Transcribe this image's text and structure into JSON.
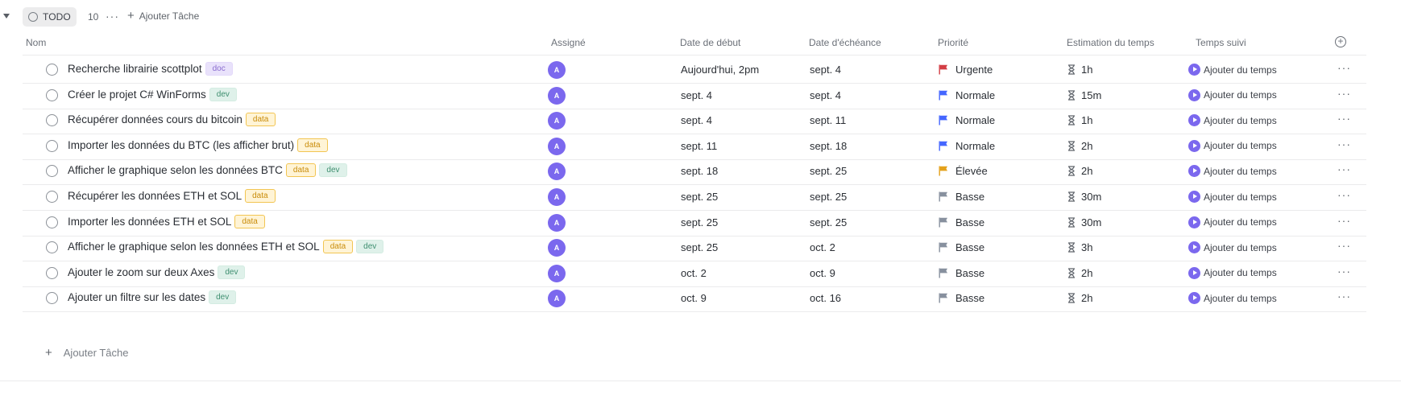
{
  "group": {
    "status_label": "TODO",
    "count": "10",
    "add_task_label": "Ajouter Tâche"
  },
  "columns": {
    "name": "Nom",
    "assignee": "Assigné",
    "start": "Date de début",
    "due": "Date d'échéance",
    "priority": "Priorité",
    "estimate": "Estimation du temps",
    "tracked": "Temps suivi"
  },
  "colors": {
    "accent": "#7b68ee",
    "priority_urgent": "#d33d44",
    "priority_high": "#e4a11b",
    "priority_normal": "#4466ff",
    "priority_low": "#87909e"
  },
  "rows": [
    {
      "name": "Recherche librairie scottplot",
      "tags": [
        "doc"
      ],
      "assignee": "A",
      "start": "Aujourd'hui, 2pm",
      "due": "sept. 4",
      "priority": "Urgente",
      "estimate": "1h",
      "tracked": "Ajouter du temps"
    },
    {
      "name": "Créer le projet C# WinForms",
      "tags": [
        "dev"
      ],
      "assignee": "A",
      "start": "sept. 4",
      "due": "sept. 4",
      "priority": "Normale",
      "estimate": "15m",
      "tracked": "Ajouter du temps"
    },
    {
      "name": "Récupérer données cours du bitcoin",
      "tags": [
        "data"
      ],
      "assignee": "A",
      "start": "sept. 4",
      "due": "sept. 11",
      "priority": "Normale",
      "estimate": "1h",
      "tracked": "Ajouter du temps"
    },
    {
      "name": "Importer les données du BTC (les afficher brut)",
      "tags": [
        "data"
      ],
      "assignee": "A",
      "start": "sept. 11",
      "due": "sept. 18",
      "priority": "Normale",
      "estimate": "2h",
      "tracked": "Ajouter du temps"
    },
    {
      "name": "Afficher le graphique selon les données BTC",
      "tags": [
        "data",
        "dev"
      ],
      "assignee": "A",
      "start": "sept. 18",
      "due": "sept. 25",
      "priority": "Élevée",
      "estimate": "2h",
      "tracked": "Ajouter du temps"
    },
    {
      "name": "Récupérer les données ETH et SOL",
      "tags": [
        "data"
      ],
      "assignee": "A",
      "start": "sept. 25",
      "due": "sept. 25",
      "priority": "Basse",
      "estimate": "30m",
      "tracked": "Ajouter du temps"
    },
    {
      "name": "Importer les données ETH et SOL",
      "tags": [
        "data"
      ],
      "assignee": "A",
      "start": "sept. 25",
      "due": "sept. 25",
      "priority": "Basse",
      "estimate": "30m",
      "tracked": "Ajouter du temps"
    },
    {
      "name": "Afficher le graphique selon les données ETH et SOL",
      "tags": [
        "data",
        "dev"
      ],
      "assignee": "A",
      "start": "sept. 25",
      "due": "oct. 2",
      "priority": "Basse",
      "estimate": "3h",
      "tracked": "Ajouter du temps"
    },
    {
      "name": "Ajouter le zoom sur deux Axes",
      "tags": [
        "dev"
      ],
      "assignee": "A",
      "start": "oct. 2",
      "due": "oct. 9",
      "priority": "Basse",
      "estimate": "2h",
      "tracked": "Ajouter du temps"
    },
    {
      "name": "Ajouter un filtre sur les dates",
      "tags": [
        "dev"
      ],
      "assignee": "A",
      "start": "oct. 9",
      "due": "oct. 16",
      "priority": "Basse",
      "estimate": "2h",
      "tracked": "Ajouter du temps"
    }
  ],
  "footer": {
    "add_task_label": "Ajouter Tâche"
  }
}
